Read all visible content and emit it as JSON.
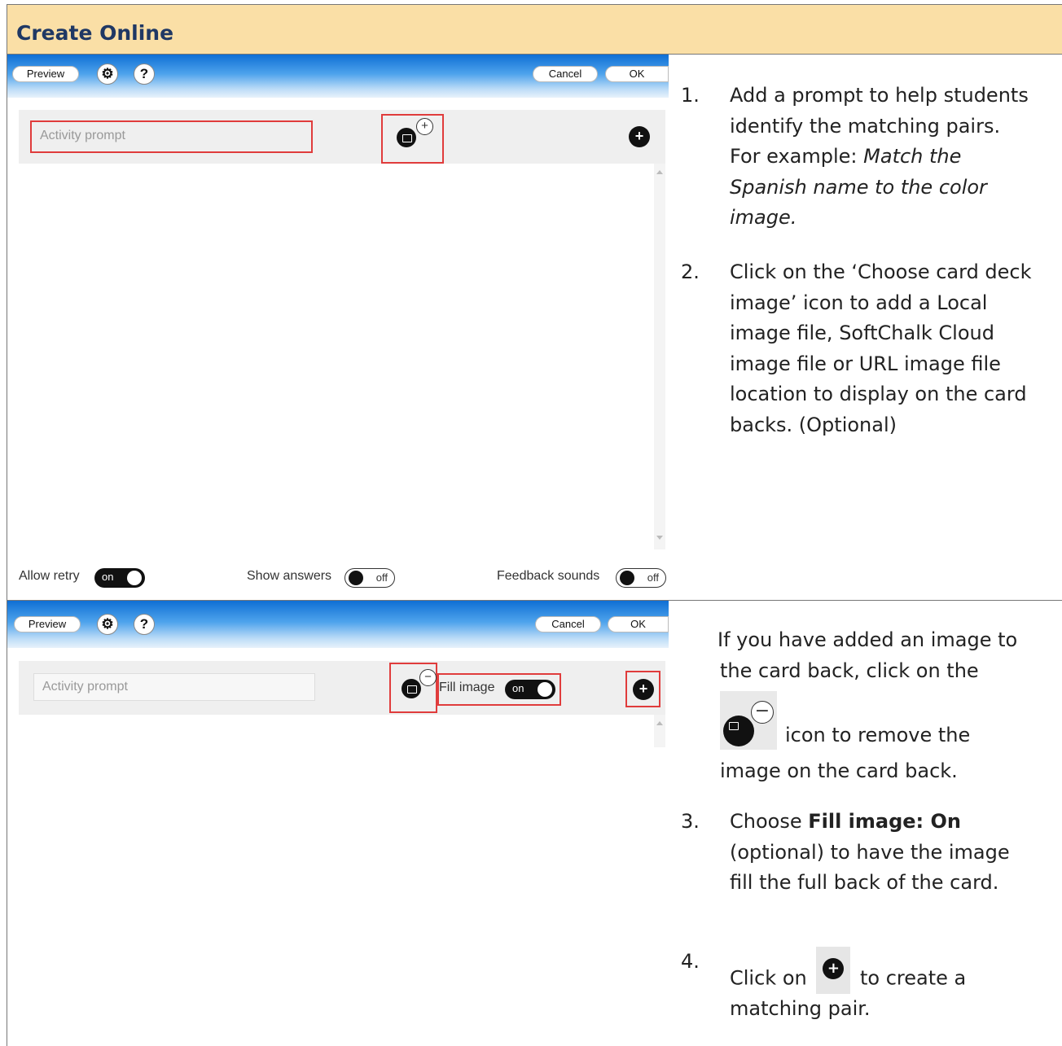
{
  "header": {
    "title": "Create Online"
  },
  "toolbar": {
    "preview": "Preview",
    "settings_icon": "gear-icon",
    "help_glyph": "?",
    "cancel": "Cancel",
    "ok": "OK"
  },
  "editor": {
    "prompt_placeholder": "Activity prompt",
    "add_image_glyph": "+",
    "remove_image_glyph": "−",
    "add_pair_glyph": "+"
  },
  "options": {
    "allow_retry": {
      "label": "Allow retry",
      "state": "on"
    },
    "show_answers": {
      "label": "Show answers",
      "state": "off"
    },
    "feedback_sounds": {
      "label": "Feedback sounds",
      "state": "off"
    },
    "fill_image": {
      "label": "Fill image",
      "state": "on"
    }
  },
  "instructions": {
    "step1": {
      "number": "1.",
      "lines": [
        "Add a prompt to help students",
        "identify the matching pairs.",
        "For example: "
      ],
      "example_italic": [
        "Match the",
        "Spanish name to the color",
        "image."
      ]
    },
    "step2": {
      "number": "2.",
      "lines": [
        "Click on the ‘Choose card deck",
        "image’ icon to add a Local",
        "image file, SoftChalk Cloud",
        "image file or URL image file",
        "location to display on the card",
        "backs. (Optional)"
      ]
    },
    "remove_note": {
      "line1": "If you have added an image to",
      "line2": "the card back, click on the",
      "line3": "icon to remove the",
      "line4": "image on the card back."
    },
    "step3": {
      "number": "3.",
      "prefix": "Choose ",
      "bold": "Fill image: On",
      "lines": [
        "(optional) to have the image",
        "fill the full back of the card."
      ]
    },
    "step4": {
      "number": "4.",
      "prefix": "Click on",
      "suffix": "to create a",
      "line2": "matching pair."
    }
  }
}
